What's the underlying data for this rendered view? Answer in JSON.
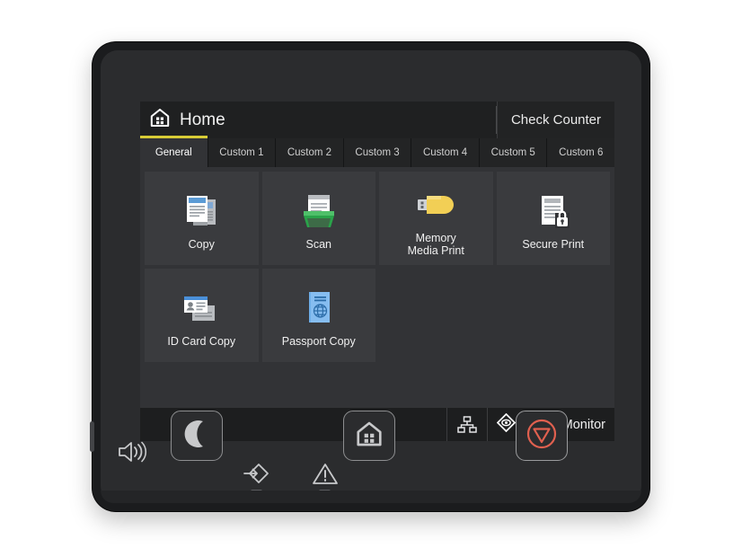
{
  "device": {
    "name": "multifunction-printer-control-panel",
    "speaker_icon": "speaker-icon"
  },
  "screen": {
    "titlebar": {
      "home_icon": "home-icon",
      "title": "Home",
      "check_counter_label": "Check Counter"
    },
    "tabs": [
      {
        "label": "General",
        "active": true
      },
      {
        "label": "Custom 1",
        "active": false
      },
      {
        "label": "Custom 2",
        "active": false
      },
      {
        "label": "Custom 3",
        "active": false
      },
      {
        "label": "Custom 4",
        "active": false
      },
      {
        "label": "Custom 5",
        "active": false
      },
      {
        "label": "Custom 6",
        "active": false
      }
    ],
    "apps": [
      {
        "label": "Copy",
        "icon": "copy-documents-icon"
      },
      {
        "label": "Scan",
        "icon": "scanner-icon"
      },
      {
        "label": "Memory\nMedia Print",
        "icon": "usb-flash-drive-icon"
      },
      {
        "label": "Secure Print",
        "icon": "document-lock-icon"
      },
      {
        "label": "ID Card Copy",
        "icon": "id-card-icon"
      },
      {
        "label": "Passport Copy",
        "icon": "passport-booklet-icon"
      }
    ],
    "statusbar": {
      "network_icon": "network-icon",
      "status_monitor_icon": "status-monitor-diamond-icon",
      "status_monitor_label": "Status Monitor"
    }
  },
  "hardware": {
    "buttons": [
      {
        "name": "sleep-button",
        "icon": "moon-icon"
      },
      {
        "name": "home-button",
        "icon": "home-icon"
      },
      {
        "name": "stop-button",
        "icon": "stop-icon"
      }
    ],
    "indicators": [
      {
        "name": "data-indicator",
        "icon": "arrow-into-diamond-icon"
      },
      {
        "name": "error-indicator",
        "icon": "warning-triangle-icon"
      }
    ]
  },
  "colors": {
    "accent_yellow": "#d8cc36",
    "stop_red": "#e0604f",
    "scan_green": "#2aa34a",
    "usb_yellow": "#f2cf55",
    "doc_blue": "#5b9bd5",
    "screen_bg": "#1a1b1c",
    "panel_bg": "#323336",
    "tile_bg": "#3a3b3e"
  }
}
